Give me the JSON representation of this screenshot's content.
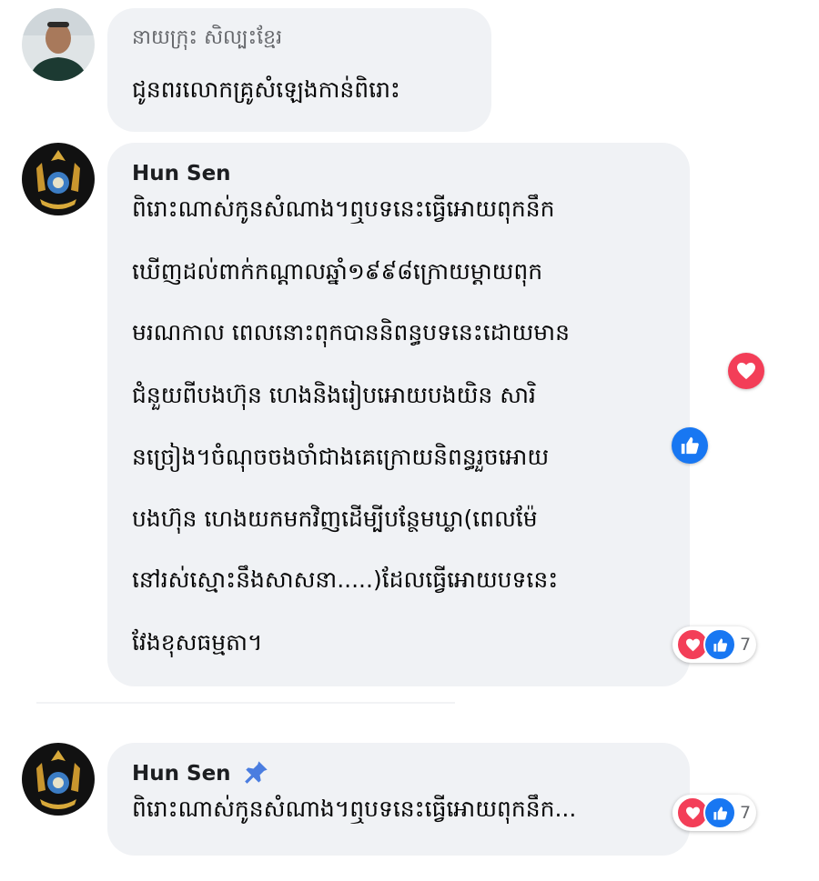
{
  "comments": [
    {
      "author": "នាយក្រុះ សិល្បះខ្មែរ",
      "text": "ជូនពរលោកគ្រូសំឡេងកាន់ពិរោះ"
    },
    {
      "author": "Hun Sen",
      "lines": [
        "ពិរោះណាស់កូនសំណាង។ឮបទនេះធ្វើអោយពុកនឹក",
        "ឃើញដល់ពាក់កណ្តាលឆ្នាំ១៩៩៨ក្រោយម្តាយពុក",
        "មរណកាល ពេលនោះពុកបាននិពន្ធបទនេះដោយមាន",
        "ជំនួយពីបងហ៊ុន ហេងនិងរៀបអោយបងយិន សារិ",
        "នច្រៀង។ចំណុចចងចាំជាងគេក្រោយនិពន្ធរួចអោយ",
        "បងហ៊ុន ហេងយកមកវិញដើម្បីបន្ថែមឃ្លា(ពេលម៉ែ",
        "នៅរស់ស្មោះនឹងសាសនា.....)ដែលធ្វើអោយបទនេះ",
        "វែងខុសធម្មតា។"
      ],
      "reaction_count": "7",
      "side_reactions": [
        "love-icon",
        "like-icon"
      ]
    },
    {
      "author": "Hun Sen",
      "pin_icon": "pin-icon",
      "text": "ពិរោះណាស់កូនសំណាង។ឮបទនេះធ្វើអោយពុកនឹក...",
      "reaction_count": "7"
    }
  ],
  "colors": {
    "bubble": "#f0f2f5",
    "love": "#f33e58",
    "like": "#1877f2",
    "pin": "#4a7de0"
  }
}
